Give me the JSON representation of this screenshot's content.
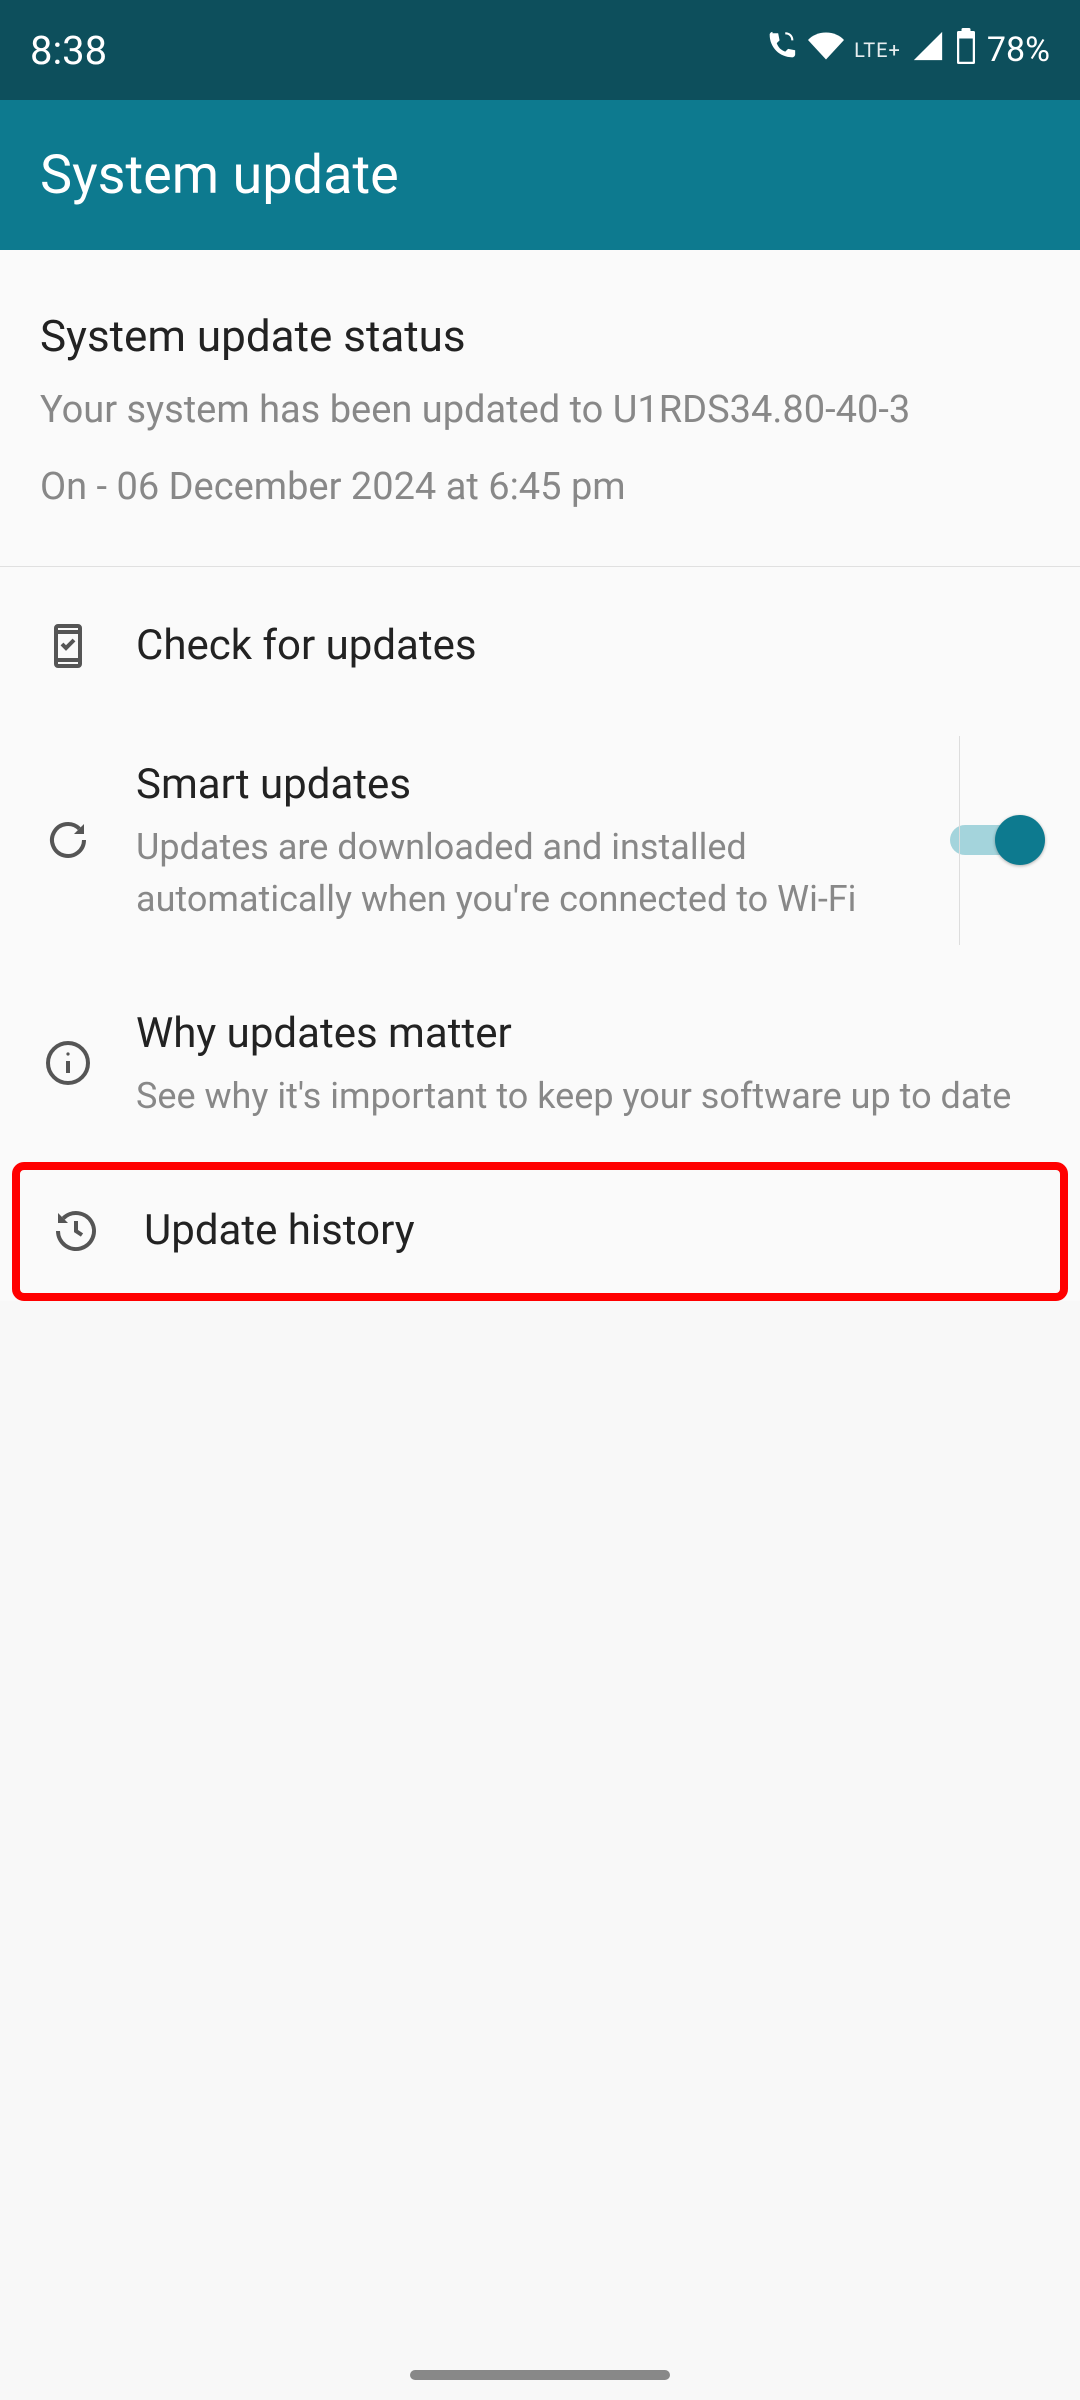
{
  "status_bar": {
    "time": "8:38",
    "network_label": "LTE+",
    "battery": "78%"
  },
  "app_bar": {
    "title": "System update"
  },
  "status_section": {
    "title": "System update status",
    "line1": "Your system has been updated to U1RDS34.80-40-3",
    "line2": "On - 06 December 2024 at 6:45 pm"
  },
  "items": {
    "check": {
      "title": "Check for updates"
    },
    "smart": {
      "title": "Smart updates",
      "sub": "Updates are downloaded and installed automatically when you're connected to Wi-Fi",
      "toggle": true
    },
    "why": {
      "title": "Why updates matter",
      "sub": "See why it's important to keep your software up to date"
    },
    "history": {
      "title": "Update history"
    }
  }
}
